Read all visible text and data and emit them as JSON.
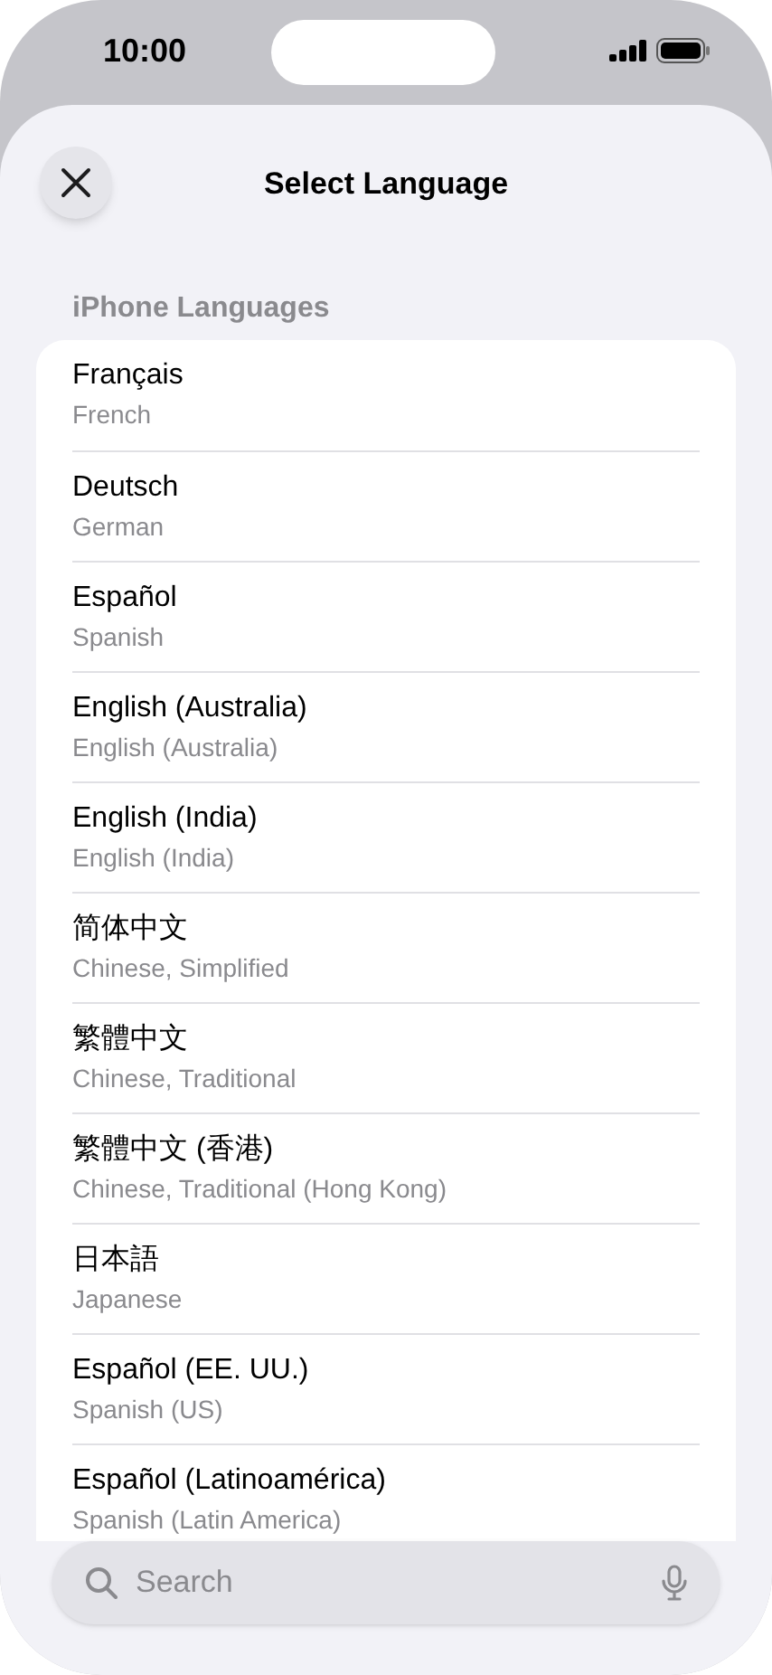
{
  "status_bar": {
    "time": "10:00"
  },
  "header": {
    "title": "Select Language"
  },
  "section": {
    "title": "iPhone Languages"
  },
  "languages": [
    {
      "name": "Français",
      "english": "French"
    },
    {
      "name": "Deutsch",
      "english": "German"
    },
    {
      "name": "Español",
      "english": "Spanish"
    },
    {
      "name": "English (Australia)",
      "english": "English (Australia)"
    },
    {
      "name": "English (India)",
      "english": "English (India)"
    },
    {
      "name": "简体中文",
      "english": "Chinese, Simplified"
    },
    {
      "name": "繁體中文",
      "english": "Chinese, Traditional"
    },
    {
      "name": "繁體中文 (香港)",
      "english": "Chinese, Traditional (Hong Kong)"
    },
    {
      "name": "日本語",
      "english": "Japanese"
    },
    {
      "name": "Español (EE. UU.)",
      "english": "Spanish (US)"
    },
    {
      "name": "Español (Latinoamérica)",
      "english": "Spanish (Latin America)"
    }
  ],
  "search": {
    "placeholder": "Search"
  }
}
